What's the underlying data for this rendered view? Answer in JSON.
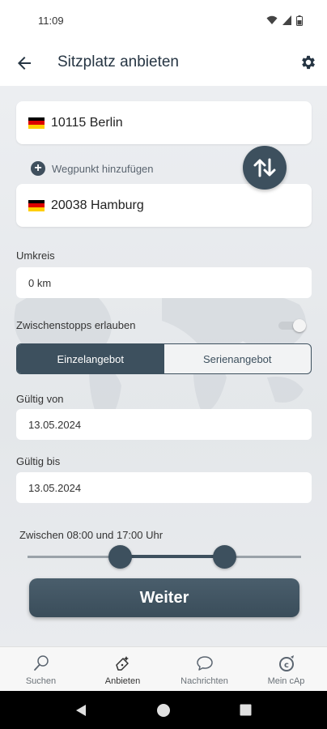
{
  "status": {
    "time": "11:09"
  },
  "appbar": {
    "title": "Sitzplatz anbieten"
  },
  "route": {
    "from": "10115 Berlin",
    "waypoint_label": "Wegpunkt hinzufügen",
    "to": "20038 Hamburg"
  },
  "umkreis": {
    "label": "Umkreis",
    "value": "0 km"
  },
  "stops": {
    "label": "Zwischenstopps erlauben",
    "enabled": false
  },
  "offer_type": {
    "options": [
      "Einzelangebot",
      "Serienangebot"
    ],
    "selected": "Einzelangebot"
  },
  "valid_from": {
    "label": "Gültig von",
    "value": "13.05.2024"
  },
  "valid_to": {
    "label": "Gültig bis",
    "value": "13.05.2024"
  },
  "time_range": {
    "label": "Zwischen 08:00 und 17:00 Uhr",
    "start_fraction": 0.34,
    "end_fraction": 0.72
  },
  "next_button": {
    "label": "Weiter"
  },
  "bottomnav": {
    "items": [
      {
        "label": "Suchen",
        "icon": "search-icon"
      },
      {
        "label": "Anbieten",
        "icon": "offer-icon"
      },
      {
        "label": "Nachrichten",
        "icon": "chat-icon"
      },
      {
        "label": "Mein cAp",
        "icon": "profile-icon"
      }
    ],
    "active": "Anbieten"
  },
  "colors": {
    "primary": "#3d505e",
    "background": "#e9ebee"
  }
}
